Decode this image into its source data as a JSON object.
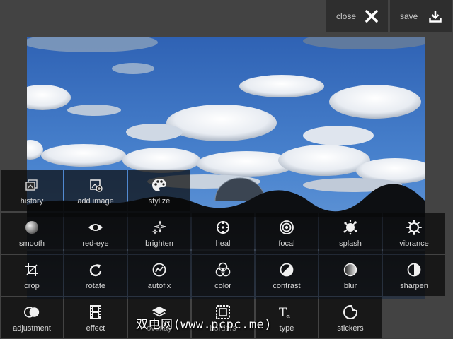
{
  "header": {
    "close_label": "close",
    "save_label": "save"
  },
  "tools_row1": [
    {
      "label": "history",
      "icon": "history-icon"
    },
    {
      "label": "add image",
      "icon": "add-image-icon"
    },
    {
      "label": "stylize",
      "icon": "palette-icon"
    }
  ],
  "tools_row2": [
    {
      "label": "smooth",
      "icon": "smooth-icon"
    },
    {
      "label": "red-eye",
      "icon": "eye-icon"
    },
    {
      "label": "brighten",
      "icon": "sparkle-icon"
    },
    {
      "label": "heal",
      "icon": "heal-icon"
    },
    {
      "label": "focal",
      "icon": "focal-icon"
    },
    {
      "label": "splash",
      "icon": "splash-icon"
    },
    {
      "label": "vibrance",
      "icon": "vibrance-icon"
    }
  ],
  "tools_row3": [
    {
      "label": "crop",
      "icon": "crop-icon"
    },
    {
      "label": "rotate",
      "icon": "rotate-icon"
    },
    {
      "label": "autofix",
      "icon": "autofix-icon"
    },
    {
      "label": "color",
      "icon": "color-icon"
    },
    {
      "label": "contrast",
      "icon": "contrast-icon"
    },
    {
      "label": "blur",
      "icon": "blur-icon"
    },
    {
      "label": "sharpen",
      "icon": "sharpen-icon"
    }
  ],
  "tools_row4": [
    {
      "label": "adjustment",
      "icon": "adjustment-icon"
    },
    {
      "label": "effect",
      "icon": "film-icon"
    },
    {
      "label": "overlay",
      "icon": "layers-icon"
    },
    {
      "label": "borders",
      "icon": "borders-icon"
    },
    {
      "label": "type",
      "icon": "type-icon"
    },
    {
      "label": "stickers",
      "icon": "sticker-icon"
    }
  ],
  "watermark": "双电网(www.pcpc.me)",
  "colors": {
    "background": "#434343",
    "panel": "#2e2e2e",
    "tile": "#0f0f0f",
    "text": "#d6d6d6",
    "sky": "#3f78c8"
  }
}
